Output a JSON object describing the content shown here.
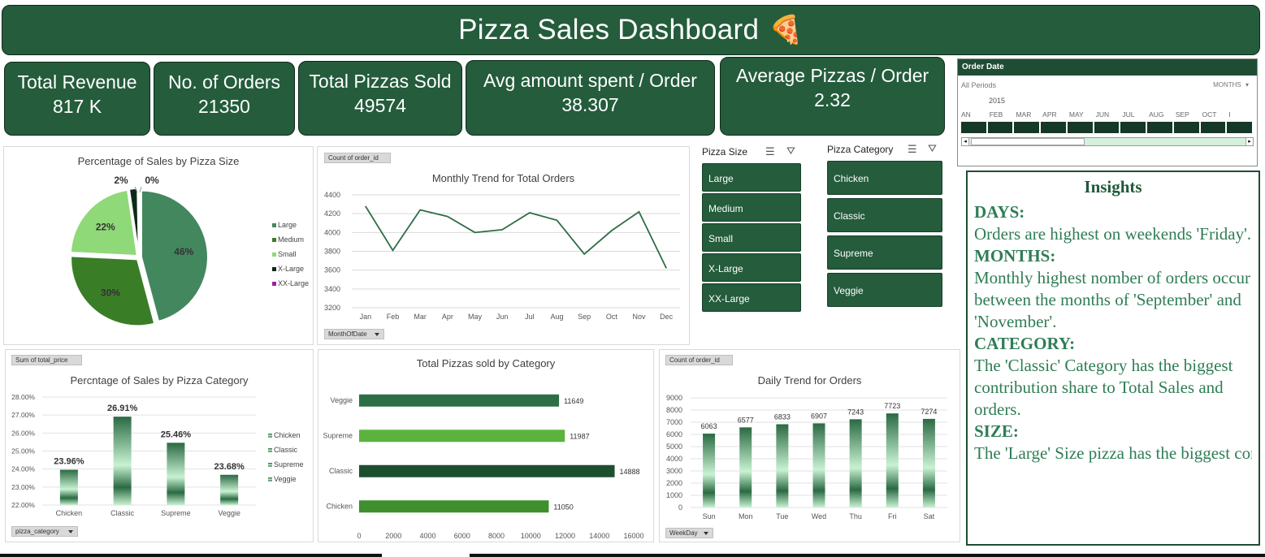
{
  "header": {
    "title": "Pizza Sales Dashboard",
    "title_icon": "pizza-icon"
  },
  "kpis": [
    {
      "label": "Total Revenue",
      "value": "817 K"
    },
    {
      "label": "No. of Orders",
      "value": "21350"
    },
    {
      "label": "Total Pizzas Sold",
      "value": "49574"
    },
    {
      "label": "Avg amount spent / Order",
      "value": "38.307"
    },
    {
      "label": "Average Pizzas / Order",
      "value": "2.32"
    }
  ],
  "timeline": {
    "title": "Order Date",
    "period_label": "All Periods",
    "level": "MONTHS",
    "year": "2015",
    "months": [
      "AN",
      "FEB",
      "MAR",
      "APR",
      "MAY",
      "JUN",
      "JUL",
      "AUG",
      "SEP",
      "OCT",
      "I"
    ]
  },
  "slicers": {
    "size": {
      "title": "Pizza Size",
      "items": [
        "Large",
        "Medium",
        "Small",
        "X-Large",
        "XX-Large"
      ]
    },
    "category": {
      "title": "Pizza Category",
      "items": [
        "Chicken",
        "Classic",
        "Supreme",
        "Veggie"
      ]
    }
  },
  "insights": {
    "title": "Insights",
    "sections": [
      {
        "heading": "DAYS:",
        "body": "Orders are highest on weekends 'Friday'."
      },
      {
        "heading": "MONTHS:",
        "body": "Monthly highest nomber of orders occur between the months of 'September' and 'November'."
      },
      {
        "heading": "CATEGORY:",
        "body": "The 'Classic' Category has the biggest contribution share to Total Sales and\norders."
      },
      {
        "heading": "SIZE:",
        "body": "The 'Large' Size pizza has the biggest contribution share to Total"
      }
    ]
  },
  "colors": {
    "primary": "#245c3c",
    "pie": [
      "#43875f",
      "#3a7d27",
      "#8fd978",
      "#0e2a17",
      "#a020a0"
    ],
    "hbars": [
      "#2e6e47",
      "#5bb33d",
      "#1c4f2e",
      "#3e8f2e"
    ]
  },
  "chart_data": [
    {
      "id": "size-pie",
      "type": "pie",
      "title": "Percentage of Sales by Pizza Size",
      "categories": [
        "Large",
        "Medium",
        "Small",
        "X-Large",
        "XX-Large"
      ],
      "values": [
        46,
        30,
        22,
        2,
        0
      ],
      "labels": [
        "46%",
        "30%",
        "22%",
        "2%",
        "0%"
      ],
      "legend": "right"
    },
    {
      "id": "monthly-line",
      "type": "line",
      "title": "Monthly Trend for Total Orders",
      "field_button": "Count of order_id",
      "axis_field": "MonthOfDate",
      "categories": [
        "Jan",
        "Feb",
        "Mar",
        "Apr",
        "May",
        "Jun",
        "Jul",
        "Aug",
        "Sep",
        "Oct",
        "Nov",
        "Dec"
      ],
      "values": [
        4280,
        3810,
        4240,
        4170,
        4000,
        4030,
        4210,
        4130,
        3770,
        4020,
        4220,
        3620
      ],
      "ylim": [
        3200,
        4400
      ],
      "yticks": [
        "3200",
        "3400",
        "3600",
        "3800",
        "4000",
        "4200",
        "4400"
      ],
      "grid": true
    },
    {
      "id": "category-column",
      "type": "bar",
      "title": "Percntage of Sales by Pizza Category",
      "field_button": "Sum of total_price",
      "axis_field": "pizza_category",
      "categories": [
        "Chicken",
        "Classic",
        "Supreme",
        "Veggie"
      ],
      "values": [
        23.96,
        26.91,
        25.46,
        23.68
      ],
      "labels": [
        "23.96%",
        "26.91%",
        "25.46%",
        "23.68%"
      ],
      "ylim": [
        22,
        28
      ],
      "yticks": [
        "22.00%",
        "23.00%",
        "24.00%",
        "25.00%",
        "26.00%",
        "27.00%",
        "28.00%"
      ],
      "legend": "right"
    },
    {
      "id": "category-hbar",
      "type": "bar",
      "orientation": "horizontal",
      "title": "Total Pizzas sold by Category",
      "categories": [
        "Veggie",
        "Supreme",
        "Classic",
        "Chicken"
      ],
      "values": [
        11649,
        11987,
        14888,
        11050
      ],
      "xlim": [
        0,
        16000
      ],
      "xticks": [
        "0",
        "2000",
        "4000",
        "6000",
        "8000",
        "10000",
        "12000",
        "14000",
        "16000"
      ]
    },
    {
      "id": "daily-column",
      "type": "bar",
      "title": "Daily Trend for Orders",
      "field_button": "Count of order_id",
      "axis_field": "WeekDay",
      "categories": [
        "Sun",
        "Mon",
        "Tue",
        "Wed",
        "Thu",
        "Fri",
        "Sat"
      ],
      "values": [
        6063,
        6577,
        6833,
        6907,
        7243,
        7723,
        7274
      ],
      "ylim": [
        0,
        9000
      ],
      "yticks": [
        "0",
        "1000",
        "2000",
        "3000",
        "4000",
        "5000",
        "6000",
        "7000",
        "8000",
        "9000"
      ]
    }
  ]
}
